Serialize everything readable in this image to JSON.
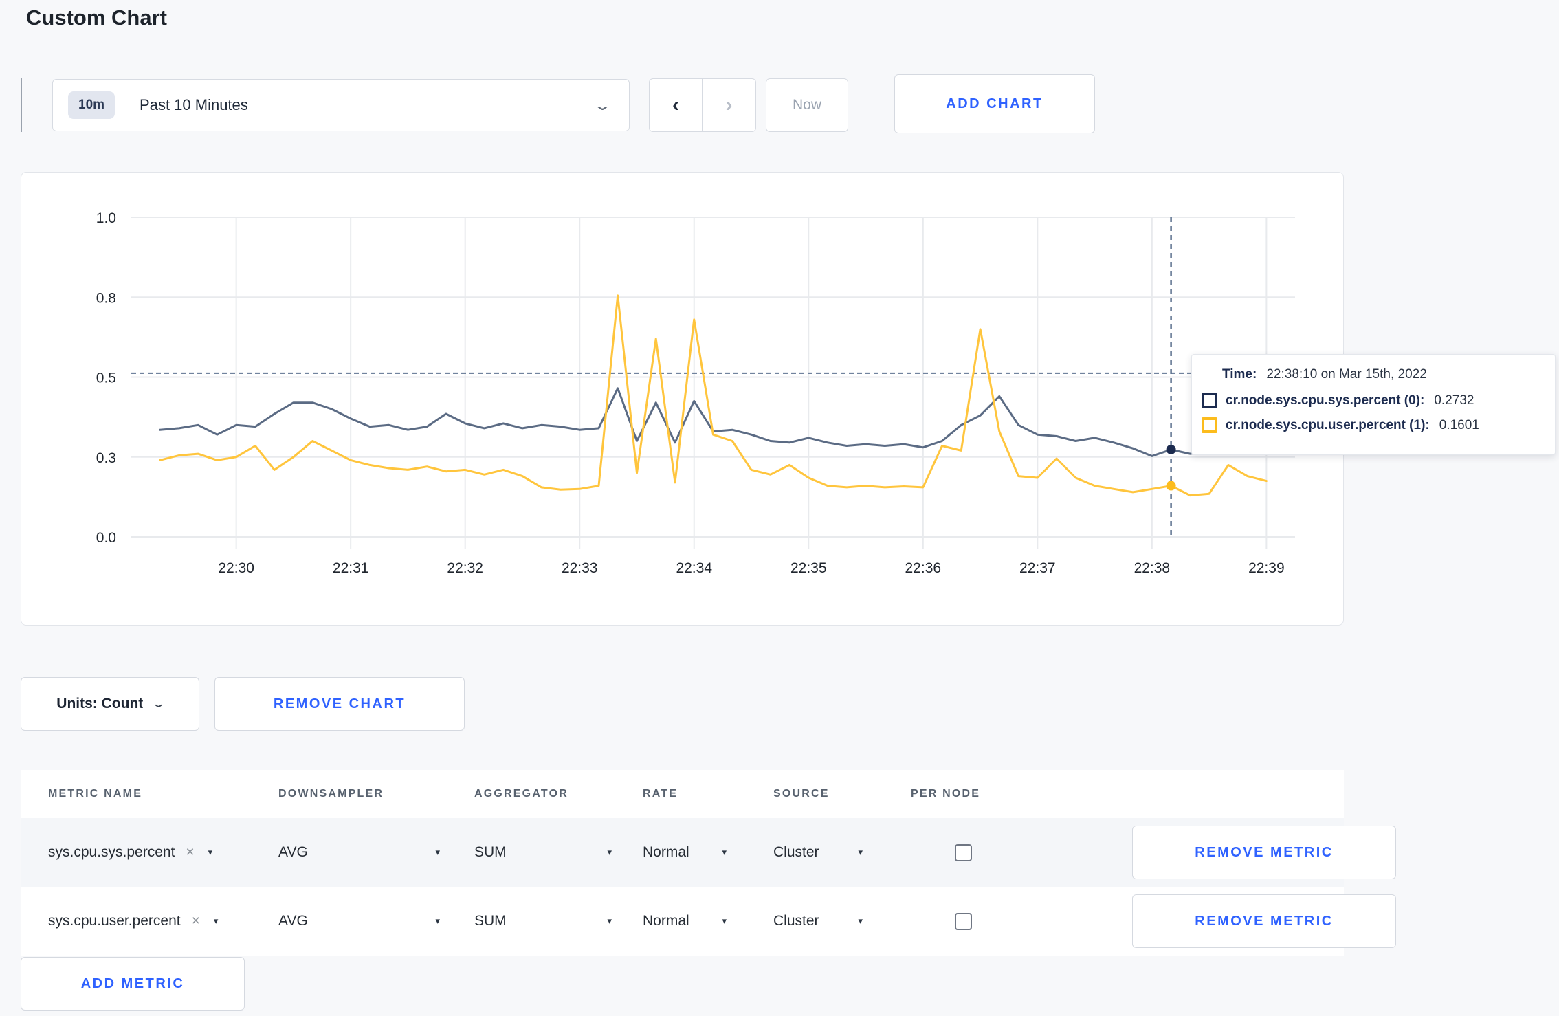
{
  "page": {
    "title": "Custom Chart",
    "background": "#f7f8fa",
    "accent_blue": "#2f62ff"
  },
  "toolbar": {
    "range_badge": "10m",
    "range_label": "Past 10 Minutes",
    "prev_icon": "‹",
    "next_icon": "›",
    "now_label": "Now",
    "add_chart_label": "ADD CHART",
    "chevron_down_icon": "⌄"
  },
  "chart_data": {
    "type": "line",
    "title": "",
    "xlabel": "",
    "ylabel": "",
    "ylim": [
      0,
      1
    ],
    "grid": true,
    "legend_position": "tooltip",
    "y_ticks": [
      {
        "value": 0.0,
        "label": "0.0"
      },
      {
        "value": 0.25,
        "label": "0.3"
      },
      {
        "value": 0.5,
        "label": "0.5"
      },
      {
        "value": 0.75,
        "label": "0.8"
      },
      {
        "value": 1.0,
        "label": "1.0"
      }
    ],
    "x_window": {
      "start": "22:29:05",
      "end": "22:39:15",
      "duration_seconds": 610
    },
    "x_ticks": [
      {
        "seconds": 55,
        "label": "22:30"
      },
      {
        "seconds": 115,
        "label": "22:31"
      },
      {
        "seconds": 175,
        "label": "22:32"
      },
      {
        "seconds": 235,
        "label": "22:33"
      },
      {
        "seconds": 295,
        "label": "22:34"
      },
      {
        "seconds": 355,
        "label": "22:35"
      },
      {
        "seconds": 415,
        "label": "22:36"
      },
      {
        "seconds": 475,
        "label": "22:37"
      },
      {
        "seconds": 535,
        "label": "22:38"
      },
      {
        "seconds": 595,
        "label": "22:39"
      }
    ],
    "sample_start_seconds": 15,
    "sample_step_seconds": 10,
    "series": [
      {
        "name": "cr.node.sys.cpu.sys.percent",
        "line_color": "#5b6b84",
        "legend_color": "#1c2b4f",
        "values": [
          0.335,
          0.34,
          0.35,
          0.32,
          0.35,
          0.345,
          0.385,
          0.42,
          0.42,
          0.4,
          0.37,
          0.345,
          0.35,
          0.335,
          0.345,
          0.385,
          0.355,
          0.34,
          0.355,
          0.34,
          0.35,
          0.345,
          0.335,
          0.34,
          0.465,
          0.3,
          0.42,
          0.295,
          0.425,
          0.33,
          0.335,
          0.32,
          0.3,
          0.295,
          0.31,
          0.295,
          0.285,
          0.29,
          0.285,
          0.29,
          0.28,
          0.3,
          0.35,
          0.38,
          0.44,
          0.35,
          0.32,
          0.315,
          0.3,
          0.31,
          0.295,
          0.277,
          0.253,
          0.2732,
          0.26,
          0.27,
          0.28,
          0.27,
          0.275
        ]
      },
      {
        "name": "cr.node.sys.cpu.user.percent",
        "line_color": "#ffc53d",
        "legend_color": "#fcbc1d",
        "values": [
          0.24,
          0.255,
          0.26,
          0.24,
          0.25,
          0.285,
          0.21,
          0.25,
          0.3,
          0.27,
          0.24,
          0.225,
          0.215,
          0.21,
          0.22,
          0.205,
          0.21,
          0.195,
          0.21,
          0.19,
          0.155,
          0.148,
          0.15,
          0.16,
          0.755,
          0.2,
          0.62,
          0.17,
          0.68,
          0.32,
          0.3,
          0.21,
          0.195,
          0.225,
          0.185,
          0.16,
          0.155,
          0.16,
          0.155,
          0.158,
          0.155,
          0.285,
          0.27,
          0.65,
          0.33,
          0.19,
          0.185,
          0.245,
          0.185,
          0.16,
          0.15,
          0.14,
          0.15,
          0.1601,
          0.13,
          0.135,
          0.225,
          0.19,
          0.175
        ]
      }
    ],
    "crosshair": {
      "seconds": 545,
      "hover_value": 0.512,
      "time_label": "22:38:10 on Mar 15th, 2022",
      "point_values": [
        0.2732,
        0.1601
      ],
      "line_color": "#5d7290"
    },
    "gridline_color": "#e8eaed",
    "tick_label_color": "#20262e"
  },
  "tooltip": {
    "time_prefix": "Time:",
    "time_value": "22:38:10 on Mar 15th, 2022",
    "rows": [
      {
        "name": "cr.node.sys.cpu.sys.percent (0):",
        "value": "0.2732",
        "color": "#1c2b4f"
      },
      {
        "name": "cr.node.sys.cpu.user.percent (1):",
        "value": "0.1601",
        "color": "#fcbc1d"
      }
    ]
  },
  "units_row": {
    "units_label": "Units: Count",
    "remove_chart_label": "REMOVE CHART"
  },
  "metrics": {
    "headers": [
      "METRIC NAME",
      "DOWNSAMPLER",
      "AGGREGATOR",
      "RATE",
      "SOURCE",
      "PER NODE"
    ],
    "rows": [
      {
        "name": "sys.cpu.sys.percent",
        "remove_x": "×",
        "downsampler": "AVG",
        "aggregator": "SUM",
        "rate": "Normal",
        "source": "Cluster",
        "per_node_checked": false,
        "remove_label": "REMOVE METRIC"
      },
      {
        "name": "sys.cpu.user.percent",
        "remove_x": "×",
        "downsampler": "AVG",
        "aggregator": "SUM",
        "rate": "Normal",
        "source": "Cluster",
        "per_node_checked": false,
        "remove_label": "REMOVE METRIC"
      }
    ],
    "caret_icon": "▾",
    "add_metric_label": "ADD METRIC"
  }
}
